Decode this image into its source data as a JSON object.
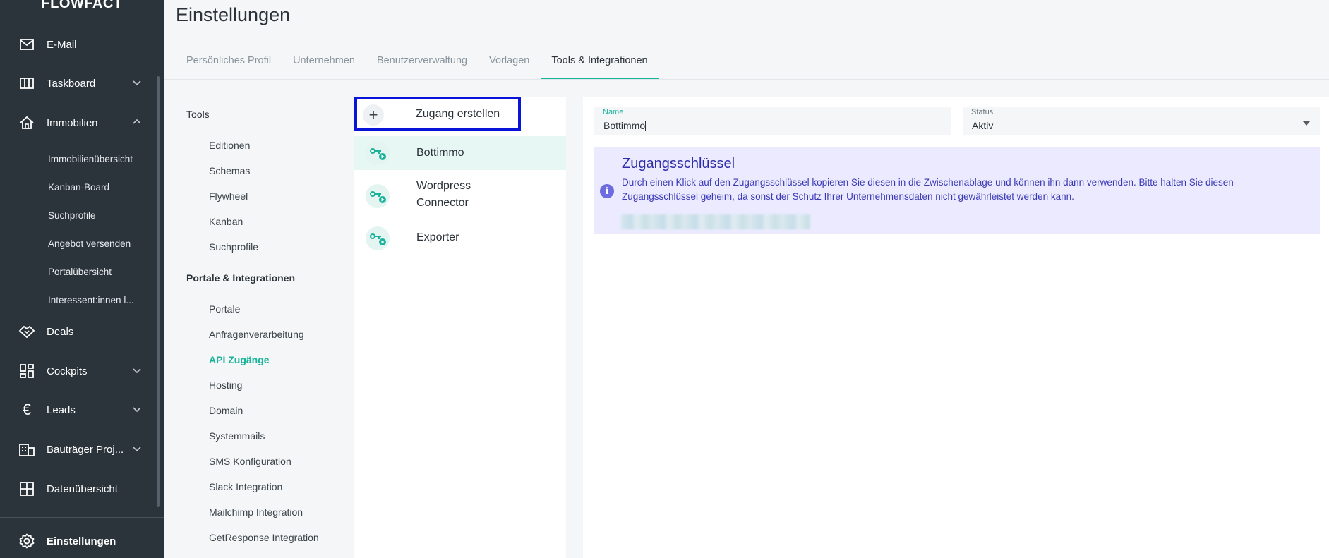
{
  "brand": "FLOWFACT",
  "sidebar": {
    "items": [
      {
        "label": "E-Mail",
        "icon": "mail-icon"
      },
      {
        "label": "Taskboard",
        "icon": "board-icon",
        "expandable": true
      },
      {
        "label": "Immobilien",
        "icon": "home-icon",
        "expanded": true
      },
      {
        "label": "Deals",
        "icon": "handshake-icon"
      },
      {
        "label": "Cockpits",
        "icon": "dashboard-icon",
        "expandable": true
      },
      {
        "label": "Leads",
        "icon": "euro-icon",
        "expandable": true
      },
      {
        "label": "Bauträger Proj...",
        "icon": "building-icon",
        "expandable": true
      },
      {
        "label": "Datenübersicht",
        "icon": "grid-icon"
      }
    ],
    "immobilien_sub": [
      "Immobilienübersicht",
      "Kanban-Board",
      "Suchprofile",
      "Angebot versenden",
      "Portalübersicht",
      "Interessent:innen l..."
    ],
    "settings": {
      "label": "Einstellungen",
      "icon": "gear-icon"
    }
  },
  "header": {
    "title": "Einstellungen",
    "tabs": [
      "Persönliches Profil",
      "Unternehmen",
      "Benutzerverwaltung",
      "Vorlagen",
      "Tools & Integrationen"
    ],
    "active_tab": "Tools & Integrationen"
  },
  "settings_nav": {
    "tools_heading": "Tools",
    "tools": [
      "Editionen",
      "Schemas",
      "Flywheel",
      "Kanban",
      "Suchprofile"
    ],
    "portals_heading": "Portale & Integrationen",
    "portals": [
      "Portale",
      "Anfragenverarbeitung",
      "API Zugänge",
      "Hosting",
      "Domain",
      "Systemmails",
      "SMS Konfiguration",
      "Slack Integration",
      "Mailchimp Integration",
      "GetResponse Integration"
    ],
    "active": "API Zugänge"
  },
  "access_list": {
    "create_label": "Zugang erstellen",
    "items": [
      {
        "label": "Bottimmo",
        "selected": true
      },
      {
        "label_line1": "Wordpress",
        "label_line2": "Connector"
      },
      {
        "label": "Exporter"
      }
    ]
  },
  "detail": {
    "name_label": "Name",
    "name_value": "Bottimmo",
    "status_label": "Status",
    "status_value": "Aktiv",
    "info_title": "Zugangsschlüssel",
    "info_text": "Durch einen Klick auf den Zugangsschlüssel kopieren Sie diesen in die Zwischenablage und können ihn dann verwenden. Bitte halten Sie diesen Zugangsschlüssel geheim, da sonst der Schutz Ihrer Unternehmensdaten nicht gewährleistet werden kann."
  },
  "colors": {
    "sidebar_bg": "#2b333b",
    "accent": "#1ab39a",
    "info_bg": "#ebeaff",
    "info_text": "#3b3ab6",
    "highlight_border": "#0a14d8"
  }
}
